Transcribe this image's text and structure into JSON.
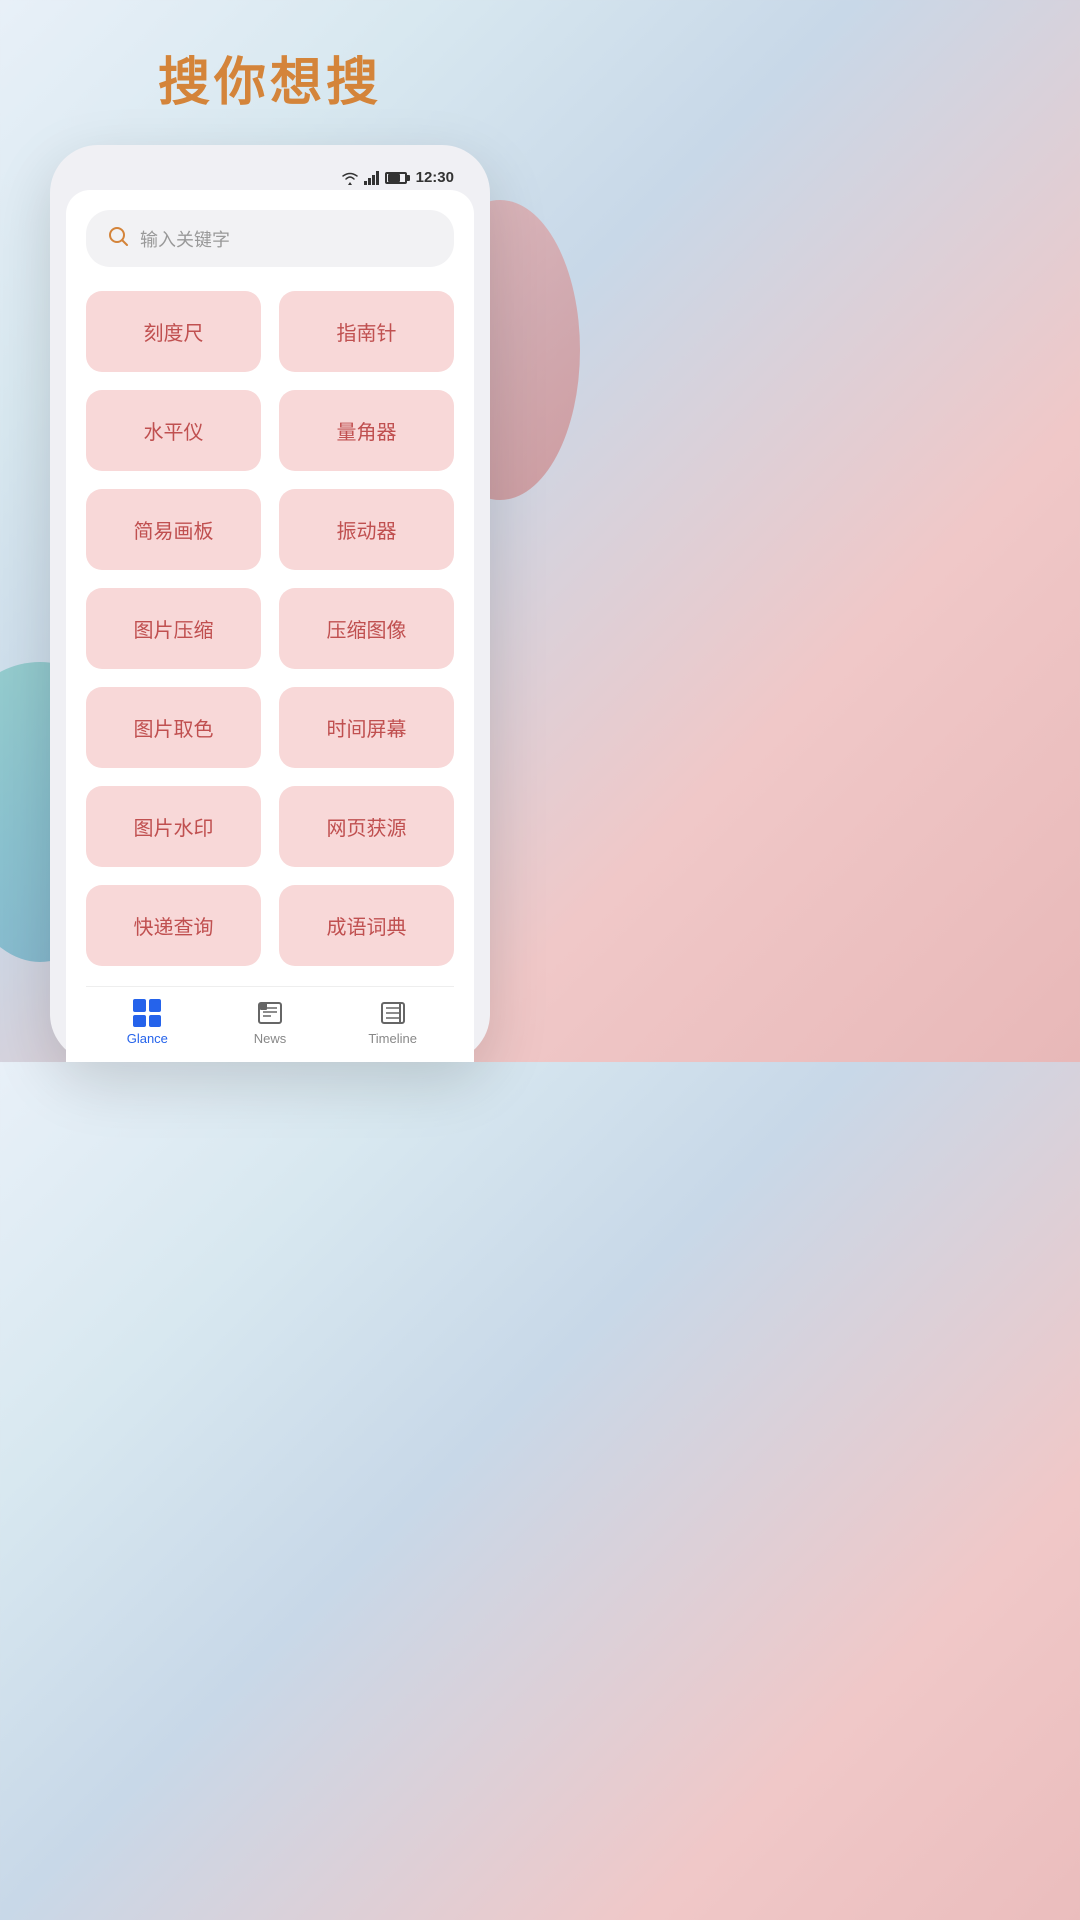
{
  "page": {
    "title": "搜你想搜",
    "title_color": "#d4843a"
  },
  "status_bar": {
    "time": "12:30"
  },
  "search": {
    "placeholder": "输入关键字"
  },
  "tools": [
    {
      "id": "ruler",
      "label": "刻度尺"
    },
    {
      "id": "compass",
      "label": "指南针"
    },
    {
      "id": "level",
      "label": "水平仪"
    },
    {
      "id": "protractor",
      "label": "量角器"
    },
    {
      "id": "sketch",
      "label": "简易画板"
    },
    {
      "id": "vibrator",
      "label": "振动器"
    },
    {
      "id": "img-compress",
      "label": "图片压缩"
    },
    {
      "id": "img-compress2",
      "label": "压缩图像"
    },
    {
      "id": "color-pick",
      "label": "图片取色"
    },
    {
      "id": "time-screen",
      "label": "时间屏幕"
    },
    {
      "id": "img-watermark",
      "label": "图片水印"
    },
    {
      "id": "web-source",
      "label": "网页获源"
    },
    {
      "id": "express",
      "label": "快递查询"
    },
    {
      "id": "idiom",
      "label": "成语词典"
    }
  ],
  "bottom_nav": {
    "items": [
      {
        "id": "glance",
        "label": "Glance",
        "active": true
      },
      {
        "id": "news",
        "label": "News",
        "active": false
      },
      {
        "id": "timeline",
        "label": "Timeline",
        "active": false
      }
    ]
  }
}
